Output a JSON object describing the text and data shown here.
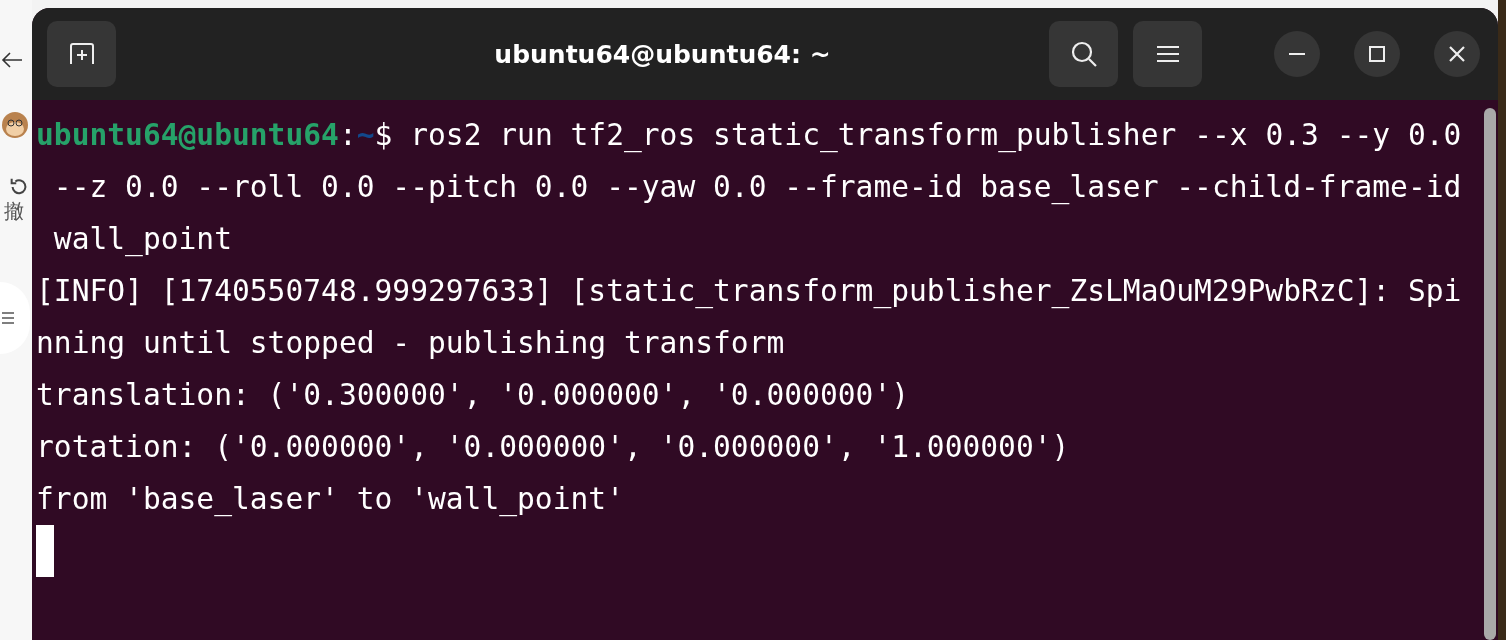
{
  "background_app": {
    "undo_label": "撤"
  },
  "window": {
    "title": "ubuntu64@ubuntu64: ~"
  },
  "terminal": {
    "lines": [
      {
        "kind": "prompt",
        "user_host": "ubuntu64@ubuntu64",
        "separator": ":",
        "path": "~",
        "command": "$ ros2 run tf2_ros static_transform_publisher --x 0.3 --y 0.0"
      },
      {
        "kind": "output",
        "text": " --z 0.0 --roll 0.0 --pitch 0.0 --yaw 0.0 --frame-id base_laser --child-frame-id"
      },
      {
        "kind": "output",
        "text": " wall_point"
      },
      {
        "kind": "output",
        "text": "[INFO] [1740550748.999297633] [static_transform_publisher_ZsLMaOuM29PwbRzC]: Spi"
      },
      {
        "kind": "output",
        "text": "nning until stopped - publishing transform"
      },
      {
        "kind": "output",
        "text": "translation: ('0.300000', '0.000000', '0.000000')"
      },
      {
        "kind": "output",
        "text": "rotation: ('0.000000', '0.000000', '0.000000', '1.000000')"
      },
      {
        "kind": "output",
        "text": "from 'base_laser' to 'wall_point'"
      },
      {
        "kind": "cursor"
      }
    ]
  }
}
